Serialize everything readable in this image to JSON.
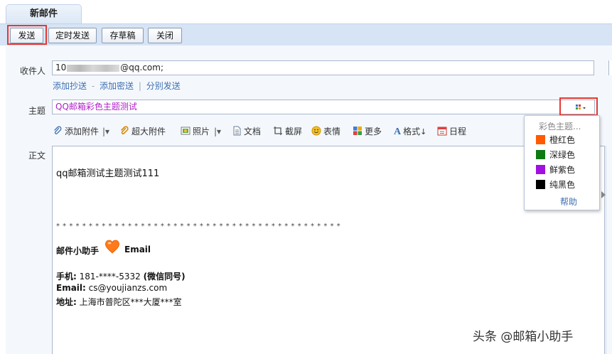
{
  "tab": {
    "title": "新邮件"
  },
  "toolbar": {
    "send": "发送",
    "schedule_send": "定时发送",
    "save_draft": "存草稿",
    "close": "关闭"
  },
  "form": {
    "to_label": "收件人",
    "to_value_prefix": "10",
    "to_value_suffix": "@qq.com;",
    "add_cc": "添加抄送",
    "dash": "-",
    "add_bcc": "添加密送",
    "pipe": "|",
    "separate_send": "分别发送",
    "subject_label": "主题",
    "subject_value": "QQ邮箱彩色主题测试",
    "subject_color": "#b020c8",
    "body_label": "正文"
  },
  "editor_toolbar": {
    "attach": "添加附件",
    "big_attach": "超大附件",
    "photo": "照片",
    "doc": "文档",
    "screenshot": "截屏",
    "emoji": "表情",
    "more": "更多",
    "format": "格式",
    "schedule": "日程"
  },
  "color_menu": {
    "title": "彩色主题...",
    "items": [
      {
        "label": "橙红色",
        "color": "#ff5a00"
      },
      {
        "label": "深绿色",
        "color": "#0d7a13"
      },
      {
        "label": "鲜紫色",
        "color": "#a010e0"
      },
      {
        "label": "纯黑色",
        "color": "#000000"
      }
    ],
    "help": "帮助"
  },
  "body": {
    "line1": "qq邮箱测试主题测试111",
    "stars": "* * * * * * * * * * * * * * * * * * * * * * * * * * * * * * * * * * * * * * * * * * * *",
    "sig_name": "邮件小助手",
    "sig_email_word": "Email",
    "phone_label": "手机:",
    "phone_value": "181-****-5332",
    "phone_note": "(微信同号)",
    "email_label": "Email:",
    "email_value": "cs@youjianzs.com",
    "address_label": "地址:",
    "address_value": "上海市普陀区***大厦***室"
  },
  "watermark": "头条 @邮箱小助手",
  "colors": {
    "toolbar_bg": "#d6e4f5",
    "accent_red": "#e53935",
    "link": "#3f6fb0"
  }
}
